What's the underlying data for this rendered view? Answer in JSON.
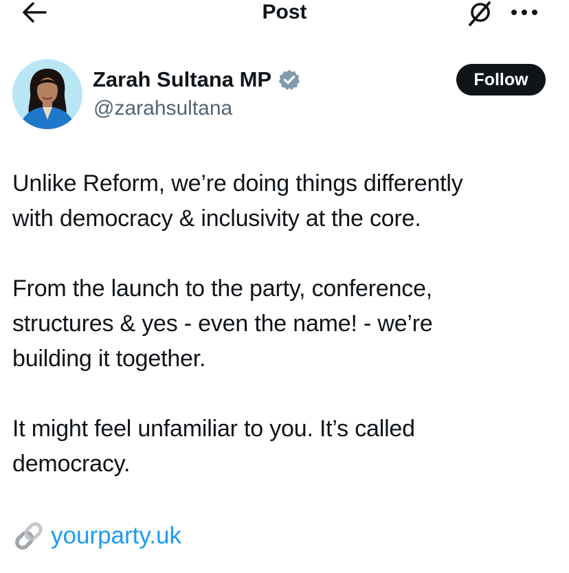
{
  "header": {
    "title": "Post",
    "back_icon": "arrow-left-icon",
    "grok_icon": "grok-icon",
    "more_icon": "more-horizontal-icon"
  },
  "author": {
    "display_name": "Zarah Sultana MP",
    "handle": "@zarahsultana",
    "verified_icon": "verified-badge-icon",
    "verified_color": "#829aab",
    "follow_label": "Follow"
  },
  "post": {
    "paragraphs": [
      "Unlike Reform, we’re doing things differently\nwith democracy & inclusivity at the core.",
      "From the launch to the party, conference,\nstructures & yes - even the name! - we’re\nbuilding it together.",
      "It might feel unfamiliar to you. It’s called\ndemocracy."
    ],
    "link_emoji": "🔗",
    "link_text": "yourparty.uk"
  },
  "colors": {
    "text": "#0f1419",
    "secondary": "#536471",
    "link": "#1d9bf0",
    "follow_bg": "#0f1419"
  }
}
